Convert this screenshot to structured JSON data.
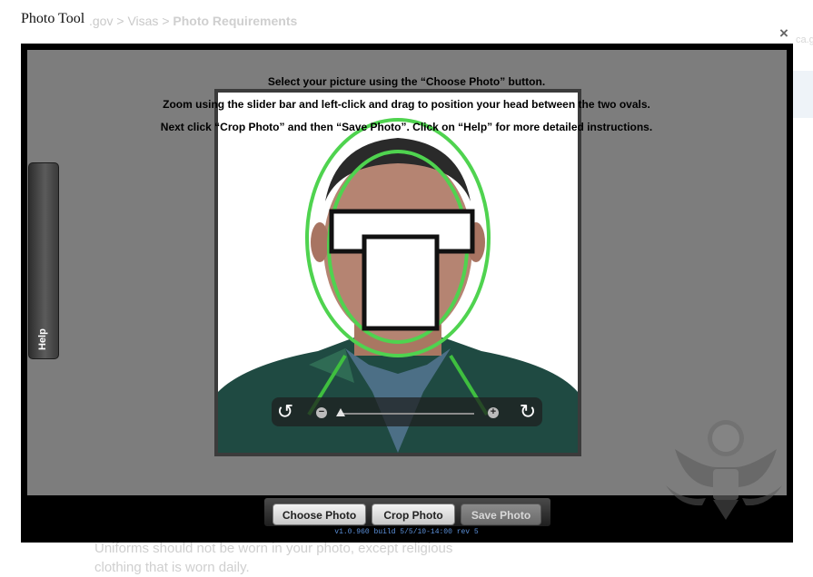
{
  "window": {
    "title": "Photo Tool",
    "close_label": "×"
  },
  "background": {
    "breadcrumb_site": ".gov",
    "breadcrumb_sep1": ">",
    "breadcrumb_mid": "Visas",
    "breadcrumb_sep2": ">",
    "breadcrumb_current": "Photo Requirements",
    "right_fragment": "ca.g",
    "bottom_line1": "Uniforms should not be worn in your photo, except religious",
    "bottom_line2": "clothing that is worn daily."
  },
  "instructions": {
    "line1": "Select your picture using the “Choose Photo” button.",
    "line2": "Zoom using the slider bar and left-click and drag to position your head between the two ovals.",
    "line3": "Next click “Crop Photo” and then “Save Photo”. Click on “Help” for more detailed instructions."
  },
  "help_tab": {
    "label": "Help"
  },
  "zoom": {
    "level": 0.02,
    "minus_label": "−",
    "plus_label": "+",
    "rotate_left_icon": "rotate-left-icon",
    "rotate_right_icon": "rotate-right-icon"
  },
  "buttons": {
    "choose": "Choose Photo",
    "crop": "Crop Photo",
    "save": "Save Photo"
  },
  "version": "v1.0.960 build 5/5/10-14:00 rev 5",
  "colors": {
    "oval_green": "#4fd34f",
    "stage_gray": "#7d7d7d",
    "version_blue": "#5b8fd8"
  }
}
